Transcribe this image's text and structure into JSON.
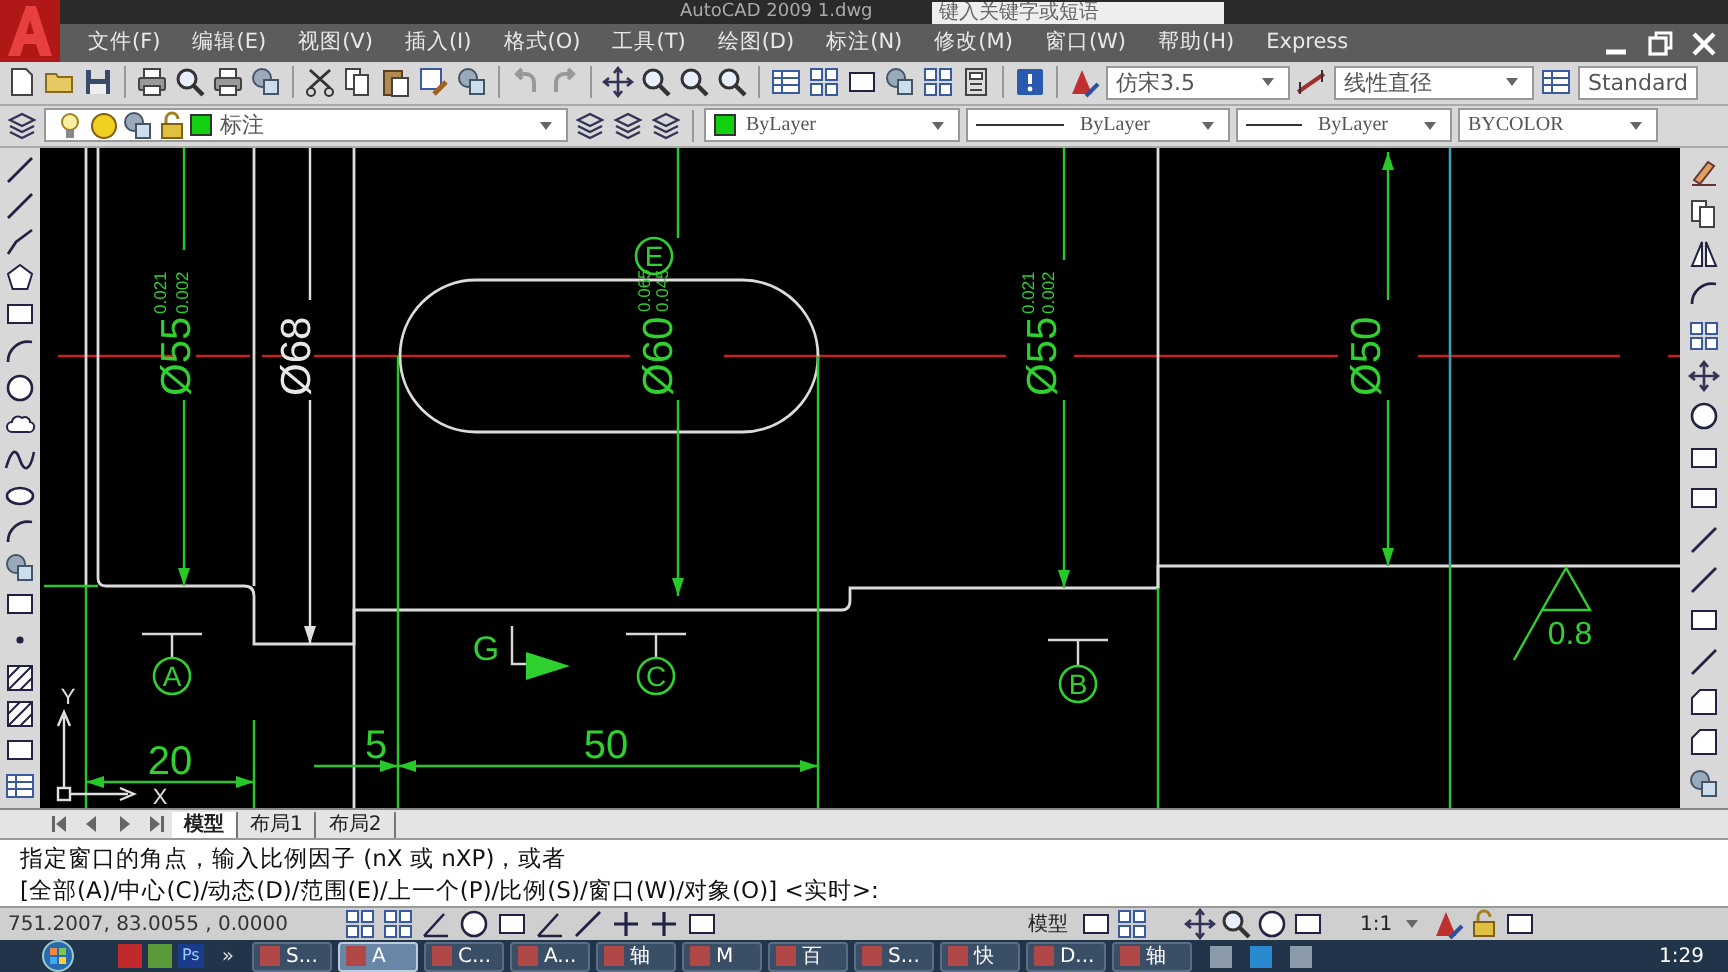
{
  "window": {
    "title": "AutoCAD 2009  1.dwg",
    "search_placeholder": "键入关键字或短语"
  },
  "menu": [
    "文件(F)",
    "编辑(E)",
    "视图(V)",
    "插入(I)",
    "格式(O)",
    "工具(T)",
    "绘图(D)",
    "标注(N)",
    "修改(M)",
    "窗口(W)",
    "帮助(H)",
    "Express"
  ],
  "toolbar": {
    "text_style": "仿宋3.5",
    "dim_style": "线性直径",
    "table_style": "Standard"
  },
  "properties_bar": {
    "layer": "标注",
    "color_setting": "ByLayer",
    "linetype": "ByLayer",
    "lineweight": "ByLayer",
    "plot_style": "BYCOLOR"
  },
  "drawing": {
    "vertical_dimensions": [
      {
        "text": "Ø55",
        "upper": "0.021",
        "lower": "0.002"
      },
      {
        "text": "Ø68"
      },
      {
        "text": "Ø60",
        "upper": "0.065",
        "lower": "0.045"
      },
      {
        "text": "Ø55",
        "upper": "0.021",
        "lower": "0.002"
      },
      {
        "text": "Ø50"
      }
    ],
    "linear_dimensions": [
      "20",
      "5",
      "50"
    ],
    "datums": [
      "E",
      "A",
      "C",
      "B"
    ],
    "section_label": "G",
    "roughness": "0.8",
    "ucs": {
      "x": "X",
      "y": "Y"
    }
  },
  "layout_tabs": [
    {
      "label": "模型",
      "selected": true
    },
    {
      "label": "布局1",
      "selected": false
    },
    {
      "label": "布局2",
      "selected": false
    }
  ],
  "command_lines": [
    "指定窗口的角点，输入比例因子 (nX 或 nXP)，或者",
    "[全部(A)/中心(C)/动态(D)/范围(E)/上一个(P)/比例(S)/窗口(W)/对象(O)] <实时>:"
  ],
  "status_bar": {
    "coordinates": "751.2007, 83.0055 , 0.0000",
    "space": "模型",
    "scale": "1:1"
  },
  "taskbar": {
    "quick_launch": "Ps",
    "more": "»",
    "items": [
      {
        "label": "S...",
        "selected": false
      },
      {
        "label": "A",
        "selected": true
      },
      {
        "label": "C...",
        "selected": false
      },
      {
        "label": "A...",
        "selected": false
      },
      {
        "label": "轴",
        "selected": false
      },
      {
        "label": "M",
        "selected": false
      },
      {
        "label": "百",
        "selected": false
      },
      {
        "label": "S...",
        "selected": false
      },
      {
        "label": "快",
        "selected": false
      },
      {
        "label": "D...",
        "selected": false
      },
      {
        "label": "轴",
        "selected": false
      }
    ],
    "clock": "1:29"
  }
}
